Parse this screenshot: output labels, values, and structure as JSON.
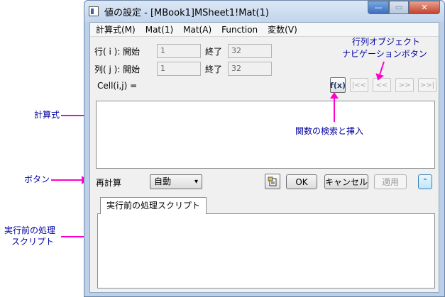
{
  "window": {
    "title": "値の設定 - [MBook1]MSheet1!Mat(1)",
    "min_symbol": "—",
    "max_symbol": "▭",
    "close_symbol": "✕"
  },
  "menu": [
    "計算式(M)",
    "Mat(1)",
    "Mat(A)",
    "Function",
    "変数(V)"
  ],
  "rows": {
    "row_label": "行( i ): 開始",
    "row_start": "1",
    "row_end_label": "終了",
    "row_end": "32",
    "col_label": "列( j ): 開始",
    "col_start": "1",
    "col_end_label": "終了",
    "col_end": "32"
  },
  "cell_label": "Cell(i,j) =",
  "find_button": "f(x)",
  "nav": [
    "|<<",
    "<<",
    ">>",
    ">>|"
  ],
  "formula": "",
  "recalc": {
    "label": "再計算",
    "value": "自動",
    "caret": "▾"
  },
  "buttons": {
    "ok": "OK",
    "cancel": "キャンセル",
    "apply": "適用",
    "collapse": "⌃"
  },
  "tab": {
    "label": "実行前の処理スクリプト",
    "content": ""
  },
  "annotations": {
    "nav_line1": "行列オブジェクト",
    "nav_line2": "ナビゲーションボタン",
    "formula": "計算式",
    "find": "関数の検索と挿入",
    "buttons": "ボタン",
    "script_line1": "実行前の処理",
    "script_line2": "スクリプト"
  },
  "colors": {
    "arrow": "#ff00cc",
    "annotation_text": "#0000a0"
  }
}
